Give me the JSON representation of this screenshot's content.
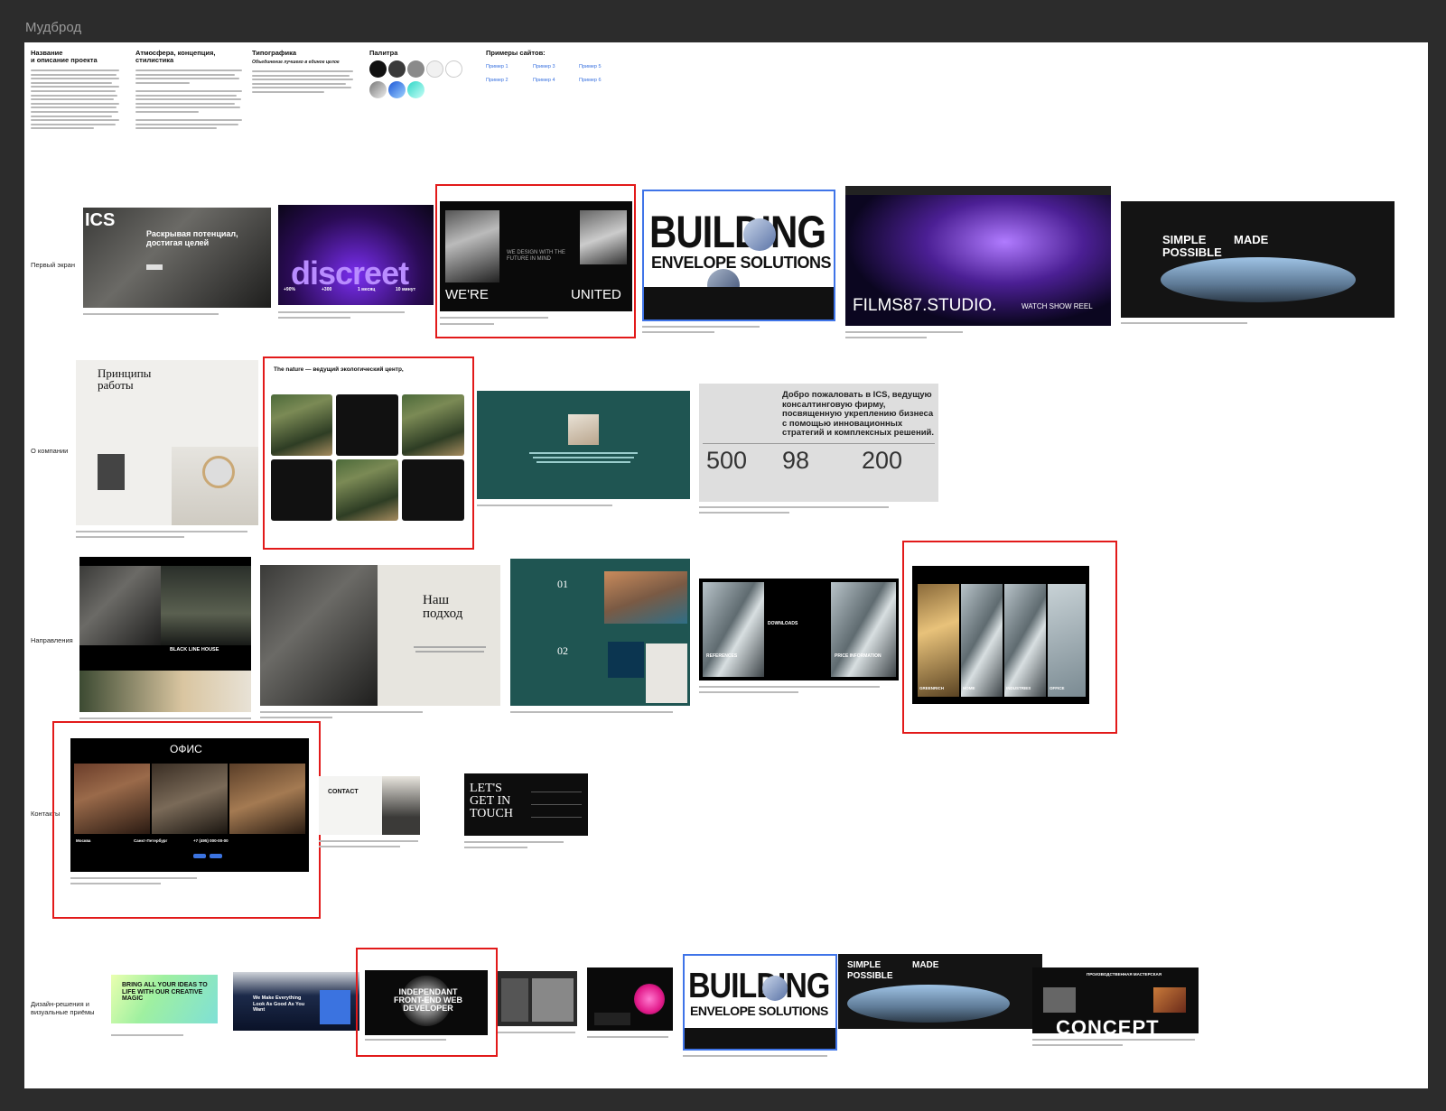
{
  "frame_title": "Мудброд",
  "header": {
    "name": {
      "title": "Название\nи описание проекта"
    },
    "mood": {
      "title": "Атмосфера, концепция,\nстилистика"
    },
    "typo": {
      "title": "Типографика",
      "subtitle": "Объединение лучшего в единое целое"
    },
    "palette": {
      "title": "Палитра",
      "colors": [
        "#111111",
        "#3a3a3a",
        "#8a8a8a",
        "#f1f1f1",
        "#ffffff"
      ]
    },
    "examples": {
      "title": "Примеры сайтов:",
      "links": [
        "Пример 1",
        "Пример 3",
        "Пример 5",
        "Пример 2",
        "Пример 4",
        "Пример 6"
      ]
    }
  },
  "sections": {
    "first_screen": "Первый экран",
    "about": "О компании",
    "directions": "Направления",
    "contacts": "Контакты",
    "design": "Дизайн-решения и визуальные приёмы"
  },
  "thumbs": {
    "ics_logo": "ICS",
    "ics_hero": "Раскрывая потенциал, достигая целей",
    "discreet_word": "discreet",
    "stat1": "+90%",
    "stat2": "+300",
    "stat3": "1 месяц",
    "stat4": "10 минут",
    "united_a": "WE DESIGN WITH THE FUTURE IN MIND",
    "united_b": "WE'RE",
    "united_c": "UNITED",
    "building1": "BUILDING",
    "building2": "ENVELOPE SOLUTIONS",
    "films": "FILMS87.STUDIO.",
    "watch": "WATCH SHOW REEL",
    "simple1": "SIMPLE",
    "simple2": "MADE",
    "simple3": "POSSIBLE",
    "principles": "Принципы работы",
    "nature_title": "The nature — ведущий экологический центр,",
    "ics_welcome": "Добро пожаловать в ICS, ведущую консалтинговую фирму, посвященную укреплению бизнеса с помощью инновационных стратегий и комплексных решений.",
    "n500": "500",
    "n98": "98",
    "n200": "200",
    "black_line": "BLACK LINE HOUSE",
    "approach": "Наш подход",
    "n01": "01",
    "n02": "02",
    "downloads": "DOWNLOADS",
    "references": "REFERENCES",
    "price": "PRICE INFORMATION",
    "greenrich": "GREENRICH",
    "home": "HOME",
    "industries": "INDUSTRIES",
    "office_tab": "OFFICE",
    "office": "ОФИС",
    "moscow": "Москва",
    "spb": "Санкт-Петербург",
    "phone": "+7 (495) 000-00-00",
    "contact": "CONTACT",
    "lets": "LET'S GET IN TOUCH",
    "creative": "BRING ALL YOUR IDEAS TO LIFE WITH OUR CREATIVE MAGIC",
    "we_make": "We Make Everything Look As Good As You Want",
    "independent": "INDEPENDANT FRONT-END WEB DEVELOPER",
    "concept": "CONCEPT",
    "master": "ПРОИЗВОДСТВЕННАЯ МАСТЕРСКАЯ"
  },
  "colors": {
    "highlight": "#e21a1a",
    "teal": "#1f5552",
    "link": "#3b73e0"
  }
}
